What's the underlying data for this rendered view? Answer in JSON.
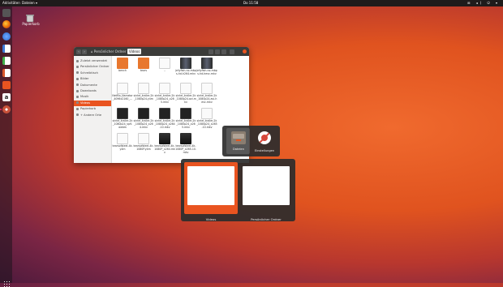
{
  "topbar": {
    "activities": "Aktivitäten",
    "app_menu": "Dateien ▾",
    "clock": "Do 11:58",
    "tray": "⊞ ◂) ⏻ ▾"
  },
  "desktop": {
    "trash_label": "Papierkorb"
  },
  "dock": {
    "items": [
      {
        "icon": "terminal-icon",
        "color": "#555555"
      },
      {
        "icon": "firefox-icon",
        "color": "#e66000"
      },
      {
        "icon": "thunderbird-icon",
        "color": "#2a6bd1"
      },
      {
        "icon": "writer-icon",
        "color": "#3b78d8"
      },
      {
        "icon": "calc-icon",
        "color": "#3fae49"
      },
      {
        "icon": "impress-icon",
        "color": "#d9572a"
      },
      {
        "icon": "software-icon",
        "color": "#e95420"
      },
      {
        "icon": "amazon-icon",
        "color": "#ffffff"
      },
      {
        "icon": "settings-icon",
        "color": "#c9523a"
      }
    ]
  },
  "file_manager": {
    "back": "‹",
    "forward": "›",
    "breadcrumb": [
      "⌂ Persönlicher Ordner",
      "Videos"
    ],
    "sidebar": [
      "Zuletzt verwendet",
      "Persönlicher Ordner",
      "Schreibtisch",
      "Bilder",
      "Dokumente",
      "Downloads",
      "Musik",
      "Videos",
      "Papierkorb",
      "+ Andere Orte"
    ],
    "selected_sidebar": 7,
    "files": [
      {
        "name": "bench",
        "kind": "folder"
      },
      {
        "name": "tears",
        "kind": "folder"
      },
      {
        "name": "–",
        "kind": "doc"
      },
      {
        "name": "jellyfish-no-mbps-hd-h264.mkv",
        "kind": "vidpic"
      },
      {
        "name": "jellyfish-no-mbps-hd-hevc.mkv",
        "kind": "vidpic"
      },
      {
        "name": "Netflix_Narrator_4096x2160_…",
        "kind": "doc"
      },
      {
        "name": "sintel_trailer-2k_1080p24.y4m",
        "kind": "doc"
      },
      {
        "name": "sintel_trailer-2k_1080p24_x265.mkv",
        "kind": "doc"
      },
      {
        "name": "sintel_trailer-2k_1080p24.avi.mkv",
        "kind": "doc"
      },
      {
        "name": "sintel_trailer-2k_1080p24.avi-hevc.mkv",
        "kind": "doc"
      },
      {
        "name": "sintel_trailer-2k_1080p24_vp9.webm",
        "kind": "vid"
      },
      {
        "name": "sintel_trailer-2k_1080p24_x264.mkv",
        "kind": "vid"
      },
      {
        "name": "sintel_trailer-2k_1080p24_x264-10.mkv",
        "kind": "vid"
      },
      {
        "name": "sintel_trailer-2k_1080p24_x265.mkv",
        "kind": "vid"
      },
      {
        "name": "sintel_trailer-2k_1080p24_x265-10.mkv",
        "kind": "doc"
      },
      {
        "name": "tearsofsteel-4k.y4m",
        "kind": "doc"
      },
      {
        "name": "tearsofsteel-4k-1080P.y4m",
        "kind": "doc"
      },
      {
        "name": "tearsofsteel-4k-1080P_x264.mkv",
        "kind": "vid2"
      },
      {
        "name": "tearsofsteel-4k-1080P_x265-10.mkv",
        "kind": "vid2"
      }
    ]
  },
  "app_switcher": {
    "apps": [
      {
        "label": "Dateien",
        "icon": "files-icon"
      },
      {
        "label": "Einstellungen",
        "icon": "settings-icon"
      }
    ],
    "windows": [
      {
        "label": "Videos",
        "selected": true
      },
      {
        "label": "Persönlicher Ordner",
        "selected": false
      }
    ]
  }
}
